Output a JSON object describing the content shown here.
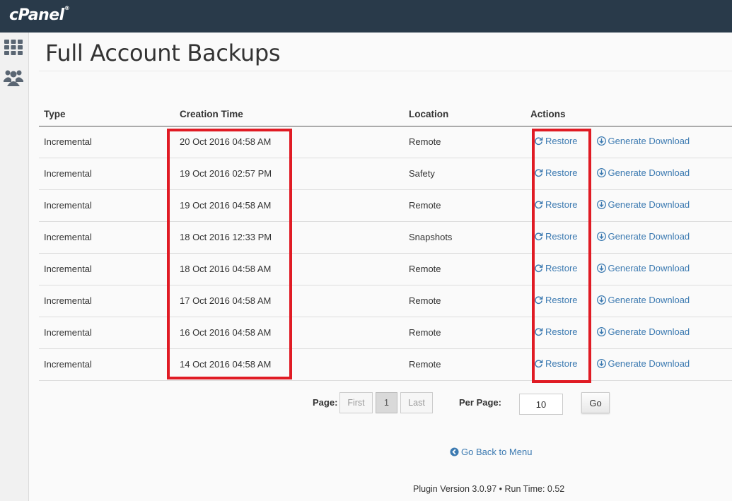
{
  "header": {
    "logo": "cPanel",
    "logo_mark": "®"
  },
  "sidebar": {
    "items": [
      {
        "icon": "grid-icon"
      },
      {
        "icon": "users-icon"
      }
    ]
  },
  "page": {
    "title": "Full Account Backups"
  },
  "table": {
    "headers": [
      "Type",
      "Creation Time",
      "Location",
      "Actions"
    ],
    "rows": [
      {
        "type": "Incremental",
        "time": "20 Oct 2016 04:58 AM",
        "location": "Remote"
      },
      {
        "type": "Incremental",
        "time": "19 Oct 2016 02:57 PM",
        "location": "Safety"
      },
      {
        "type": "Incremental",
        "time": "19 Oct 2016 04:58 AM",
        "location": "Remote"
      },
      {
        "type": "Incremental",
        "time": "18 Oct 2016 12:33 PM",
        "location": "Snapshots"
      },
      {
        "type": "Incremental",
        "time": "18 Oct 2016 04:58 AM",
        "location": "Remote"
      },
      {
        "type": "Incremental",
        "time": "17 Oct 2016 04:58 AM",
        "location": "Remote"
      },
      {
        "type": "Incremental",
        "time": "16 Oct 2016 04:58 AM",
        "location": "Remote"
      },
      {
        "type": "Incremental",
        "time": "14 Oct 2016 04:58 AM",
        "location": "Remote"
      }
    ],
    "restore_label": "Restore",
    "download_label": "Generate Download"
  },
  "pagination": {
    "page_label": "Page:",
    "first": "First",
    "current": "1",
    "last": "Last",
    "per_page_label": "Per Page:",
    "per_page_value": "10",
    "go": "Go"
  },
  "links": {
    "back": "Go Back to Menu"
  },
  "footer": {
    "text": "Plugin Version 3.0.97 • Run Time: 0.52"
  },
  "colors": {
    "topbar": "#293a4a",
    "link": "#3c7ab1",
    "highlight": "#e01b24"
  }
}
